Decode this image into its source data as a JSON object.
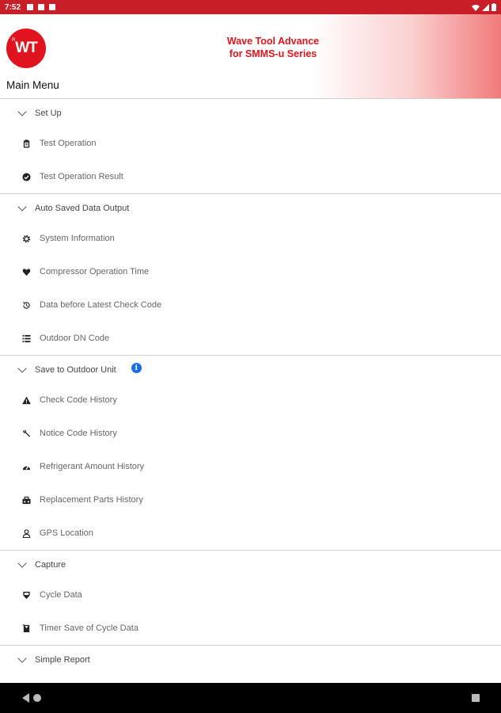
{
  "status_bar": {
    "time": "7:52"
  },
  "header": {
    "logo_text": "WT",
    "logo_sup": "R",
    "title_line1": "Wave Tool Advance",
    "title_line2": "for SMMS-u Series",
    "page_title": "Main Menu"
  },
  "sections": [
    {
      "label": "Set Up",
      "items": [
        {
          "label": "Test Operation",
          "icon": "clipboard-icon"
        },
        {
          "label": "Test Operation Result",
          "icon": "check-circle-icon"
        }
      ]
    },
    {
      "label": "Auto Saved Data Output",
      "items": [
        {
          "label": "System Information",
          "icon": "gear-icon"
        },
        {
          "label": "Compressor Operation Time",
          "icon": "heart-icon"
        },
        {
          "label": "Data before Latest Check Code",
          "icon": "history-icon"
        },
        {
          "label": "Outdoor DN Code",
          "icon": "list-icon"
        }
      ]
    },
    {
      "label": "Save to Outdoor Unit",
      "info_icon": "info-icon",
      "items": [
        {
          "label": "Check Code History",
          "icon": "warning-icon"
        },
        {
          "label": "Notice Code History",
          "icon": "wrench-icon"
        },
        {
          "label": "Refrigerant Amount History",
          "icon": "gauge-icon"
        },
        {
          "label": "Replacement Parts History",
          "icon": "toolbox-icon"
        },
        {
          "label": "GPS Location",
          "icon": "person-pin-icon"
        }
      ]
    },
    {
      "label": "Capture",
      "items": [
        {
          "label": "Cycle Data",
          "icon": "capture-icon"
        },
        {
          "label": "Timer Save of Cycle Data",
          "icon": "timer-icon"
        }
      ]
    },
    {
      "label": "Simple Report",
      "items": []
    }
  ],
  "colors": {
    "brand_red": "#e0141e",
    "status_bar": "#c81e28",
    "info_blue": "#1a6de8"
  }
}
